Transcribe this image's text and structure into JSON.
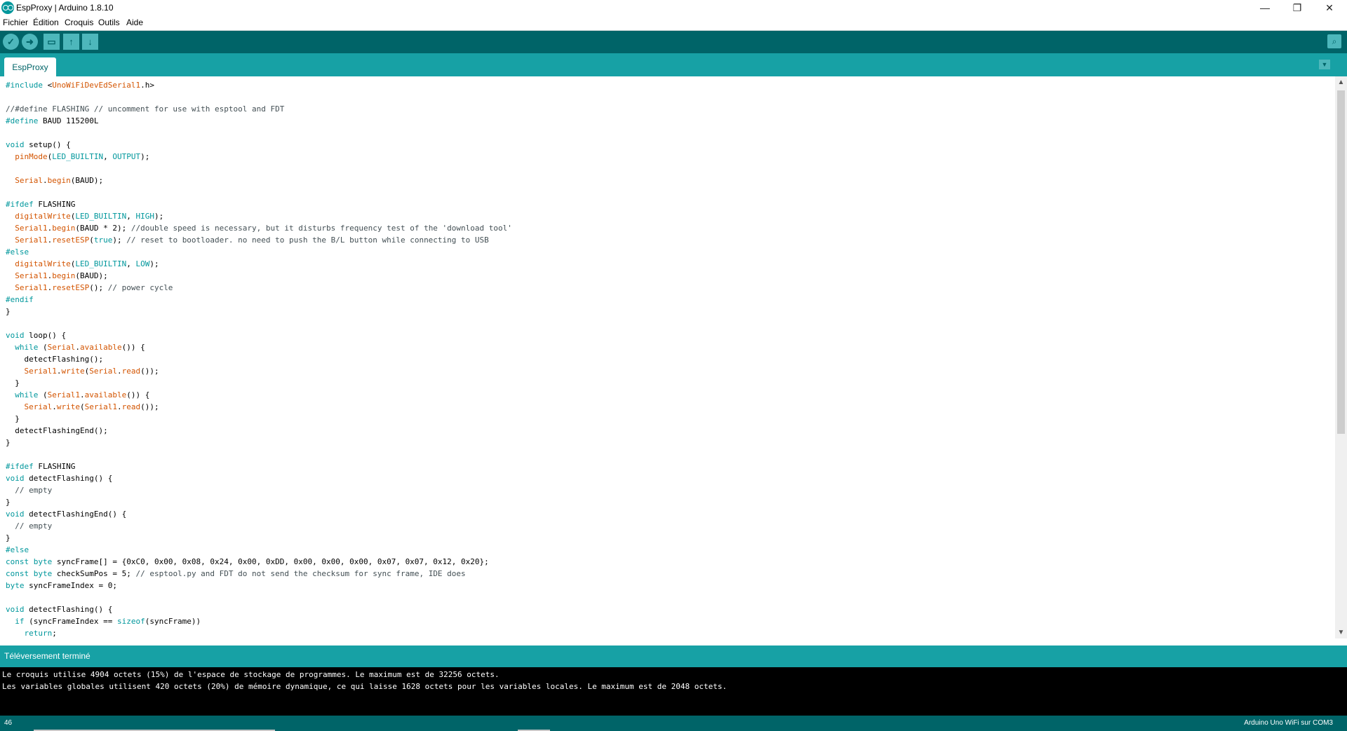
{
  "window": {
    "title": "EspProxy | Arduino 1.8.10",
    "minimize_glyph": "—",
    "restore_glyph": "❐",
    "close_glyph": "✕"
  },
  "menu": {
    "items": [
      "Fichier",
      "Édition",
      "Croquis",
      "Outils",
      "Aide"
    ]
  },
  "toolbar": {
    "verify_glyph": "✓",
    "upload_glyph": "➜",
    "new_glyph": "▭",
    "open_glyph": "↑",
    "save_glyph": "↓",
    "serial_glyph": "⌕"
  },
  "tabs": {
    "active_label": "EspProxy",
    "menu_glyph": "▼"
  },
  "colors": {
    "toolbar_bg": "#006468",
    "tab_bar_bg": "#17a1a5",
    "keyword": "#00979c",
    "function": "#d35400",
    "comment": "#434f54",
    "console_bg": "#000000"
  },
  "editor": {
    "lines": [
      "#include <UnoWiFiDevEdSerial1.h>",
      "",
      "//#define FLASHING // uncomment for use with esptool and FDT",
      "#define BAUD 115200L",
      "",
      "void setup() {",
      "  pinMode(LED_BUILTIN, OUTPUT);",
      "",
      "  Serial.begin(BAUD);",
      "",
      "#ifdef FLASHING",
      "  digitalWrite(LED_BUILTIN, HIGH);",
      "  Serial1.begin(BAUD * 2); //double speed is necessary, but it disturbs frequency test of the 'download tool'",
      "  Serial1.resetESP(true); // reset to bootloader. no need to push the B/L button while connecting to USB",
      "#else",
      "  digitalWrite(LED_BUILTIN, LOW);",
      "  Serial1.begin(BAUD);",
      "  Serial1.resetESP(); // power cycle",
      "#endif",
      "}",
      "",
      "void loop() {",
      "  while (Serial.available()) {",
      "    detectFlashing();",
      "    Serial1.write(Serial.read());",
      "  }",
      "  while (Serial1.available()) {",
      "    Serial.write(Serial1.read());",
      "  }",
      "  detectFlashingEnd();",
      "}",
      "",
      "#ifdef FLASHING",
      "void detectFlashing() {",
      "  // empty",
      "}",
      "void detectFlashingEnd() {",
      "  // empty",
      "}",
      "#else",
      "const byte syncFrame[] = {0xC0, 0x00, 0x08, 0x24, 0x00, 0xDD, 0x00, 0x00, 0x00, 0x07, 0x07, 0x12, 0x20};",
      "const byte checkSumPos = 5; // esptool.py and FDT do not send the checksum for sync frame, IDE does",
      "byte syncFrameIndex = 0;",
      "",
      "void detectFlashing() {",
      "  if (syncFrameIndex == sizeof(syncFrame))",
      "    return;"
    ]
  },
  "scrollbar": {
    "up_glyph": "▲",
    "down_glyph": "▼"
  },
  "status": {
    "message": "Téléversement terminé"
  },
  "console": {
    "lines": [
      "Le croquis utilise 4904 octets (15%) de l'espace de stockage de programmes. Le maximum est de 32256 octets.",
      "Les variables globales utilisent 420 octets (20%) de mémoire dynamique, ce qui laisse 1628 octets pour les variables locales. Le maximum est de 2048 octets."
    ]
  },
  "footer": {
    "line_number": "46",
    "board": "Arduino Uno WiFi sur COM3"
  }
}
